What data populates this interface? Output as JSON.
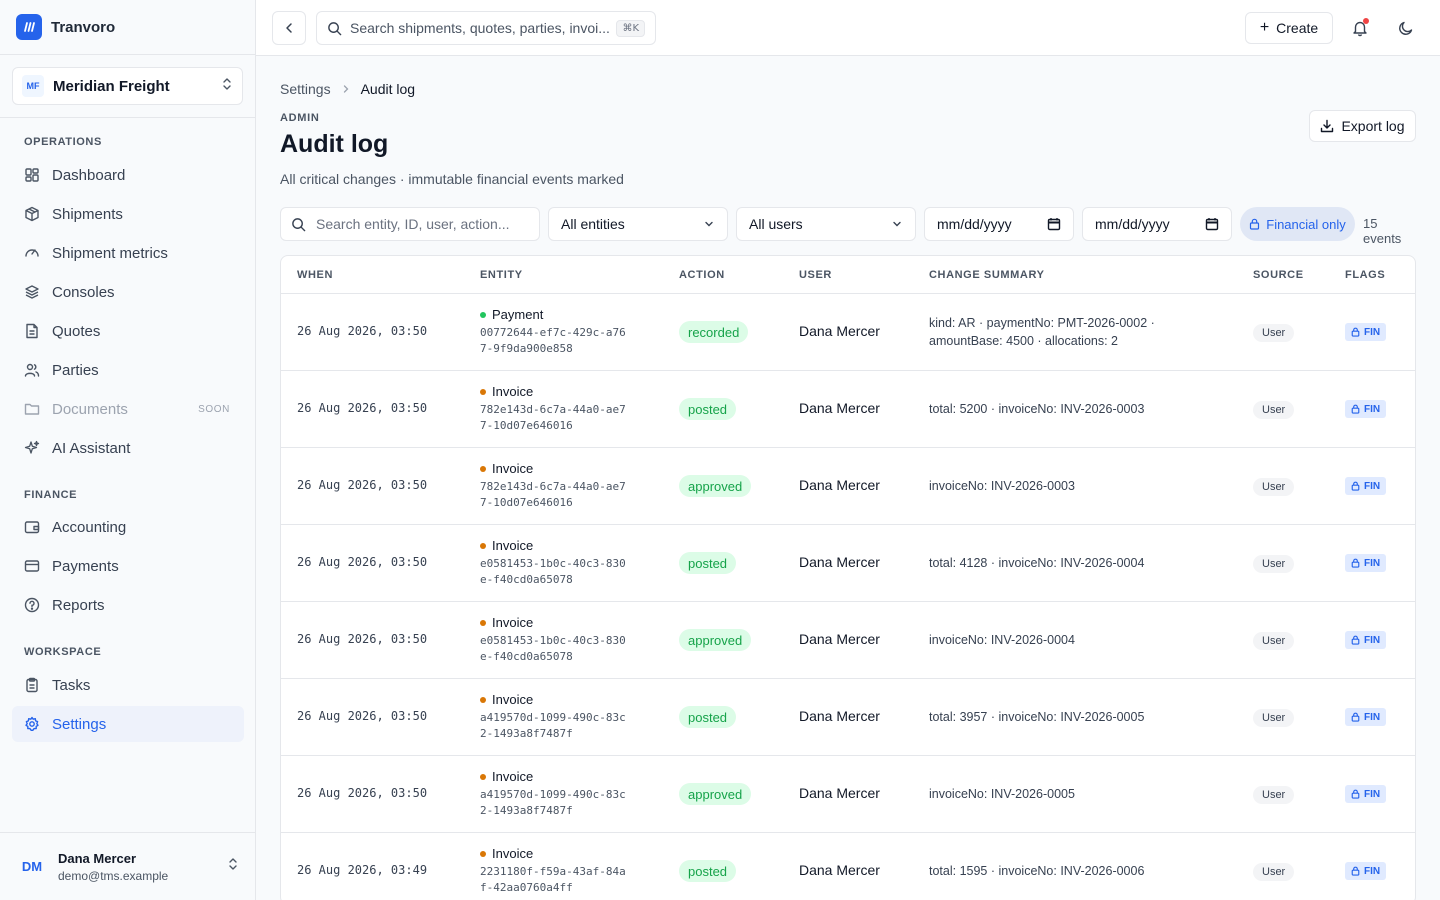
{
  "brand": {
    "name": "Tranvoro"
  },
  "org": {
    "initials": "MF",
    "name": "Meridian Freight"
  },
  "sidebar": {
    "sections": [
      {
        "label": "OPERATIONS"
      },
      {
        "label": "FINANCE"
      },
      {
        "label": "WORKSPACE"
      }
    ],
    "items": [
      {
        "label": "Dashboard",
        "icon": "dashboard-icon"
      },
      {
        "label": "Shipments",
        "icon": "package-icon"
      },
      {
        "label": "Shipment metrics",
        "icon": "gauge-icon"
      },
      {
        "label": "Consoles",
        "icon": "layers-icon"
      },
      {
        "label": "Quotes",
        "icon": "document-icon"
      },
      {
        "label": "Parties",
        "icon": "users-icon"
      },
      {
        "label": "Documents",
        "icon": "folder-icon",
        "badge": "SOON",
        "disabled": true
      },
      {
        "label": "AI Assistant",
        "icon": "sparkles-icon"
      },
      {
        "label": "Accounting",
        "icon": "wallet-icon"
      },
      {
        "label": "Payments",
        "icon": "credit-card-icon"
      },
      {
        "label": "Reports",
        "icon": "help-circle-icon"
      },
      {
        "label": "Tasks",
        "icon": "clipboard-icon"
      },
      {
        "label": "Settings",
        "icon": "gear-icon",
        "active": true
      }
    ]
  },
  "user": {
    "initials": "DM",
    "name": "Dana Mercer",
    "email": "demo@tms.example"
  },
  "topbar": {
    "search_placeholder": "Search shipments, quotes, parties, invoi...",
    "shortcut": "⌘K",
    "create_label": "Create"
  },
  "page": {
    "breadcrumb": [
      "Settings",
      "Audit log"
    ],
    "eyebrow": "ADMIN",
    "title": "Audit log",
    "subtitle": "All critical changes · immutable financial events marked",
    "export_label": "Export log"
  },
  "filters": {
    "search_placeholder": "Search entity, ID, user, action...",
    "entity_select": "All entities",
    "user_select": "All users",
    "date_from": "mm/dd/yyyy",
    "date_to": "mm/dd/yyyy",
    "financial_toggle": "Financial only",
    "count": "15 events"
  },
  "table": {
    "columns": [
      "WHEN",
      "ENTITY",
      "ACTION",
      "USER",
      "CHANGE SUMMARY",
      "SOURCE",
      "FLAGS"
    ],
    "rows": [
      {
        "when": "26 Aug 2026, 03:50",
        "entity": "Payment",
        "id": "00772644-ef7c-429c-a767-9f9da900e858",
        "action": "recorded",
        "user": "Dana Mercer",
        "summary": "kind: AR · paymentNo: PMT-2026-0002 · amountBase: 4500 · allocations: 2",
        "source": "User",
        "flag": "FIN"
      },
      {
        "when": "26 Aug 2026, 03:50",
        "entity": "Invoice",
        "id": "782e143d-6c7a-44a0-ae77-10d07e646016",
        "action": "posted",
        "user": "Dana Mercer",
        "summary": "total: 5200 · invoiceNo: INV-2026-0003",
        "source": "User",
        "flag": "FIN"
      },
      {
        "when": "26 Aug 2026, 03:50",
        "entity": "Invoice",
        "id": "782e143d-6c7a-44a0-ae77-10d07e646016",
        "action": "approved",
        "user": "Dana Mercer",
        "summary": "invoiceNo: INV-2026-0003",
        "source": "User",
        "flag": "FIN"
      },
      {
        "when": "26 Aug 2026, 03:50",
        "entity": "Invoice",
        "id": "e0581453-1b0c-40c3-830e-f40cd0a65078",
        "action": "posted",
        "user": "Dana Mercer",
        "summary": "total: 4128 · invoiceNo: INV-2026-0004",
        "source": "User",
        "flag": "FIN"
      },
      {
        "when": "26 Aug 2026, 03:50",
        "entity": "Invoice",
        "id": "e0581453-1b0c-40c3-830e-f40cd0a65078",
        "action": "approved",
        "user": "Dana Mercer",
        "summary": "invoiceNo: INV-2026-0004",
        "source": "User",
        "flag": "FIN"
      },
      {
        "when": "26 Aug 2026, 03:50",
        "entity": "Invoice",
        "id": "a419570d-1099-490c-83c2-1493a8f7487f",
        "action": "posted",
        "user": "Dana Mercer",
        "summary": "total: 3957 · invoiceNo: INV-2026-0005",
        "source": "User",
        "flag": "FIN"
      },
      {
        "when": "26 Aug 2026, 03:50",
        "entity": "Invoice",
        "id": "a419570d-1099-490c-83c2-1493a8f7487f",
        "action": "approved",
        "user": "Dana Mercer",
        "summary": "invoiceNo: INV-2026-0005",
        "source": "User",
        "flag": "FIN"
      },
      {
        "when": "26 Aug 2026, 03:49",
        "entity": "Invoice",
        "id": "2231180f-f59a-43af-84af-42aa0760a4ff",
        "action": "posted",
        "user": "Dana Mercer",
        "summary": "total: 1595 · invoiceNo: INV-2026-0006",
        "source": "User",
        "flag": "FIN"
      }
    ]
  },
  "colors": {
    "accent": "#2563eb",
    "payment_dot": "#22c55e",
    "invoice_dot": "#d97706",
    "action_bg": "#dcfce7",
    "action_text": "#16a34a"
  }
}
